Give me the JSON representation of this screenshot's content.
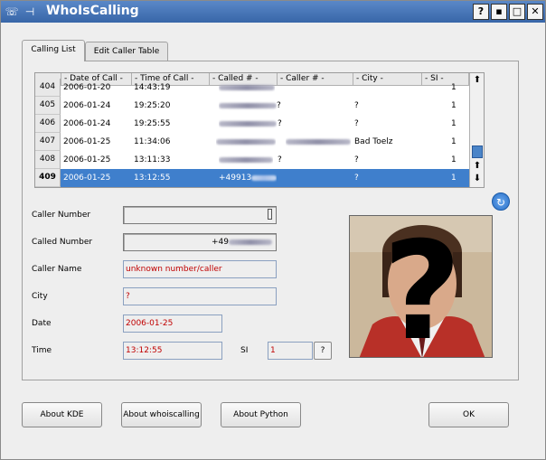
{
  "window": {
    "title": "WhoIsCalling",
    "buttons": [
      "?",
      "▪",
      "□",
      "✕"
    ]
  },
  "tabs": [
    {
      "label": "Calling List",
      "active": true
    },
    {
      "label": "Edit Caller Table",
      "active": false
    }
  ],
  "table": {
    "columns": [
      "- Date of Call -",
      "- Time of Call -",
      "- Called # -",
      "- Caller # -",
      "- City -",
      "- SI -"
    ],
    "rows": [
      {
        "id": "404",
        "date": "2006-01-20",
        "time": "14:43:19",
        "called": "",
        "caller": "",
        "city": "",
        "si": "1"
      },
      {
        "id": "405",
        "date": "2006-01-24",
        "time": "19:25:20",
        "called": "",
        "caller": "?",
        "city": "?",
        "si": "1"
      },
      {
        "id": "406",
        "date": "2006-01-24",
        "time": "19:25:55",
        "called": "",
        "caller": "?",
        "city": "?",
        "si": "1"
      },
      {
        "id": "407",
        "date": "2006-01-25",
        "time": "11:34:06",
        "called": "",
        "caller": "",
        "city": "Bad Toelz",
        "si": "1"
      },
      {
        "id": "408",
        "date": "2006-01-25",
        "time": "13:11:33",
        "called": "",
        "caller": "?",
        "city": "?",
        "si": "1"
      },
      {
        "id": "409",
        "date": "2006-01-25",
        "time": "13:12:55",
        "called": "+49913",
        "caller": "",
        "city": "?",
        "si": "1",
        "selected": true
      }
    ]
  },
  "form": {
    "caller_number_label": "Caller Number",
    "called_number_label": "Called Number",
    "called_number_value": "+49",
    "caller_name_label": "Caller Name",
    "caller_name_value": "unknown number/caller",
    "city_label": "City",
    "city_value": "?",
    "date_label": "Date",
    "date_value": "2006-01-25",
    "time_label": "Time",
    "time_value": "13:12:55",
    "si_label": "SI",
    "si_value": "1",
    "si_button": "?"
  },
  "buttons": {
    "about_kde": "About KDE",
    "about_whoiscalling": "About whoiscalling",
    "about_python": "About Python",
    "ok": "OK"
  },
  "colors": {
    "titlebar": "#3866a8",
    "selection": "#3f7fcc",
    "field_text": "#c00000"
  }
}
